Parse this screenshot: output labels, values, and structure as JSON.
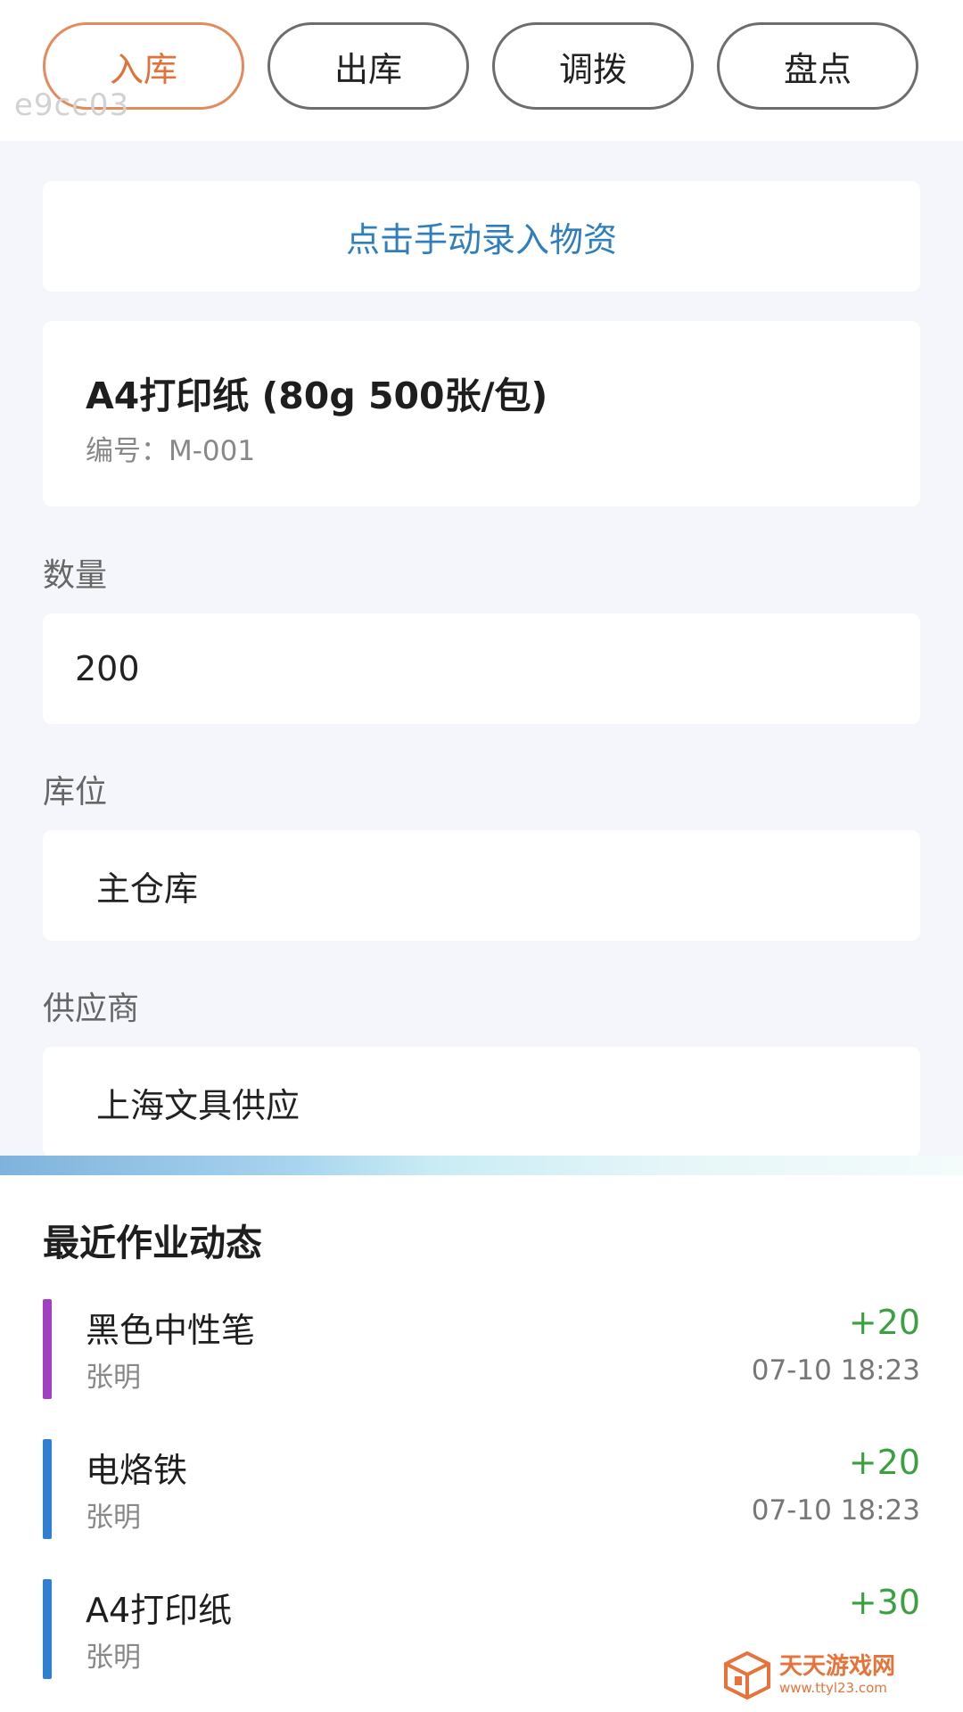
{
  "tabs": [
    {
      "label": "入库",
      "active": true
    },
    {
      "label": "出库",
      "active": false
    },
    {
      "label": "调拨",
      "active": false
    },
    {
      "label": "盘点",
      "active": false
    }
  ],
  "watermark_code": "e9cc03",
  "manual_entry_label": "点击手动录入物资",
  "item": {
    "title": "A4打印纸 (80g 500张/包)",
    "code": "编号：M-001"
  },
  "form": {
    "quantity_label": "数量",
    "quantity_value": "200",
    "location_label": "库位",
    "location_value": "主仓库",
    "supplier_label": "供应商",
    "supplier_value": "上海文具供应"
  },
  "recent": {
    "title": "最近作业动态",
    "items": [
      {
        "name": "黑色中性笔",
        "user": "张明",
        "qty": "+20",
        "time": "07-10 18:23",
        "bar_color": "#a23fc2"
      },
      {
        "name": "电烙铁",
        "user": "张明",
        "qty": "+20",
        "time": "07-10 18:23",
        "bar_color": "#2f80d0"
      },
      {
        "name": "A4打印纸",
        "user": "张明",
        "qty": "+30",
        "time": "",
        "bar_color": "#2f80d0"
      }
    ]
  },
  "colors": {
    "accent": "#e0733c",
    "link": "#2f7fbf",
    "positive": "#3aa040"
  },
  "brand": {
    "name": "天天游戏网",
    "url": "www.ttyl23.com"
  }
}
